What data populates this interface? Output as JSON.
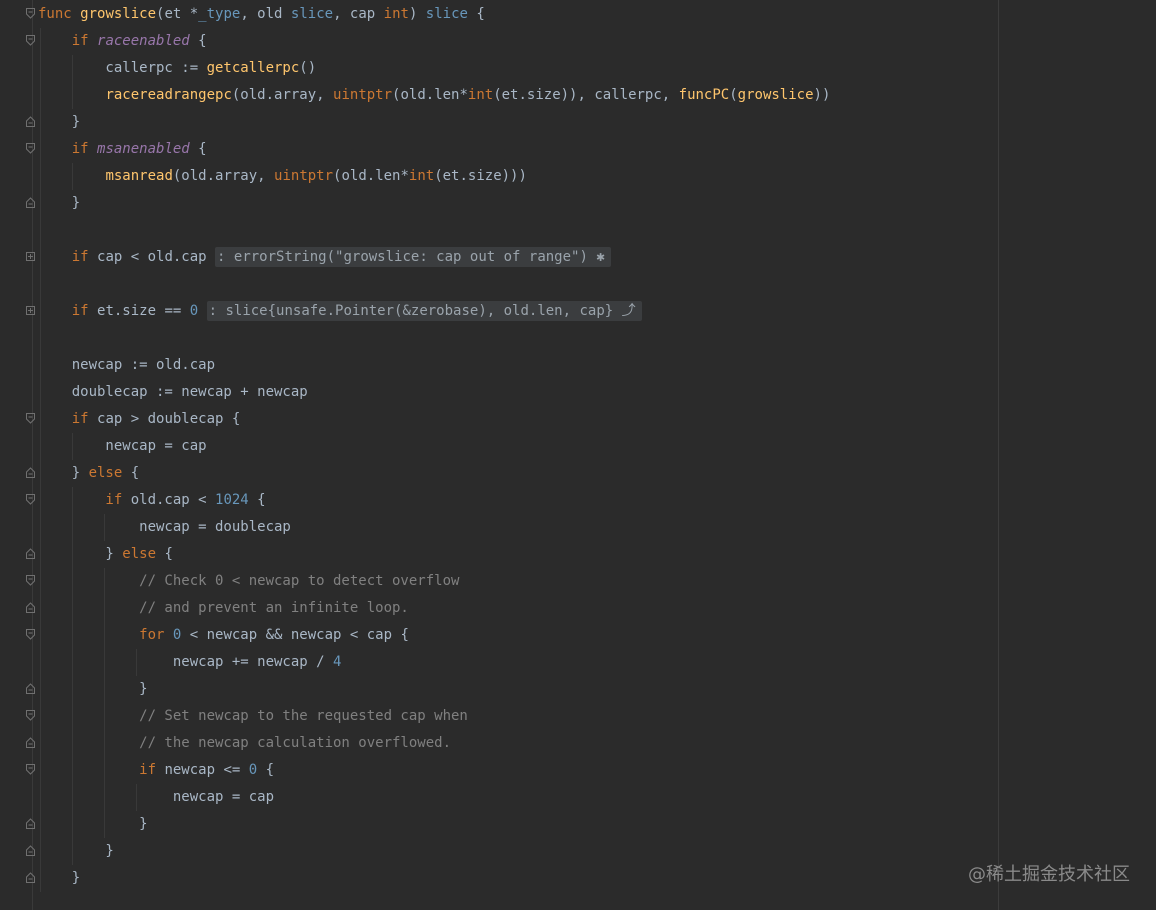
{
  "code_lines": [
    [
      {
        "t": "func ",
        "c": "kw"
      },
      {
        "t": "growslice",
        "c": "fn"
      },
      {
        "t": "(et *",
        "c": "plain"
      },
      {
        "t": "_type",
        "c": "ty2"
      },
      {
        "t": ", old ",
        "c": "plain"
      },
      {
        "t": "slice",
        "c": "ty2"
      },
      {
        "t": ", cap ",
        "c": "plain"
      },
      {
        "t": "int",
        "c": "ty"
      },
      {
        "t": ") ",
        "c": "plain"
      },
      {
        "t": "slice",
        "c": "ty2"
      },
      {
        "t": " {",
        "c": "plain"
      }
    ],
    [
      {
        "t": "    if ",
        "c": "kw"
      },
      {
        "t": "raceenabled",
        "c": "it"
      },
      {
        "t": " {",
        "c": "plain"
      }
    ],
    [
      {
        "t": "        callerpc := ",
        "c": "plain"
      },
      {
        "t": "getcallerpc",
        "c": "call"
      },
      {
        "t": "()",
        "c": "plain"
      }
    ],
    [
      {
        "t": "        ",
        "c": "plain"
      },
      {
        "t": "racereadrangepc",
        "c": "call"
      },
      {
        "t": "(old.array, ",
        "c": "plain"
      },
      {
        "t": "uintptr",
        "c": "kw"
      },
      {
        "t": "(old.len*",
        "c": "plain"
      },
      {
        "t": "int",
        "c": "kw"
      },
      {
        "t": "(et.size)), callerpc, ",
        "c": "plain"
      },
      {
        "t": "funcPC",
        "c": "call"
      },
      {
        "t": "(",
        "c": "plain"
      },
      {
        "t": "growslice",
        "c": "fn"
      },
      {
        "t": "))",
        "c": "plain"
      }
    ],
    [
      {
        "t": "    }",
        "c": "plain"
      }
    ],
    [
      {
        "t": "    if ",
        "c": "kw"
      },
      {
        "t": "msanenabled",
        "c": "it"
      },
      {
        "t": " {",
        "c": "plain"
      }
    ],
    [
      {
        "t": "        ",
        "c": "plain"
      },
      {
        "t": "msanread",
        "c": "call"
      },
      {
        "t": "(old.array, ",
        "c": "plain"
      },
      {
        "t": "uintptr",
        "c": "kw"
      },
      {
        "t": "(old.len*",
        "c": "plain"
      },
      {
        "t": "int",
        "c": "kw"
      },
      {
        "t": "(et.size)))",
        "c": "plain"
      }
    ],
    [
      {
        "t": "    }",
        "c": "plain"
      }
    ],
    [],
    [
      {
        "t": "    if ",
        "c": "kw"
      },
      {
        "t": "cap < old.cap ",
        "c": "plain"
      },
      {
        "t": ": errorString(\"growslice: cap out of range\") ✱",
        "c": "fold-region"
      }
    ],
    [],
    [
      {
        "t": "    if ",
        "c": "kw"
      },
      {
        "t": "et.size == ",
        "c": "plain"
      },
      {
        "t": "0",
        "c": "num"
      },
      {
        "t": " ",
        "c": "plain"
      },
      {
        "t": ": slice{unsafe.Pointer(&zerobase), old.len, cap} ⤴",
        "c": "fold-region"
      }
    ],
    [],
    [
      {
        "t": "    newcap := old.cap",
        "c": "plain"
      }
    ],
    [
      {
        "t": "    doublecap := newcap + newcap",
        "c": "plain"
      }
    ],
    [
      {
        "t": "    if ",
        "c": "kw"
      },
      {
        "t": "cap > doublecap {",
        "c": "plain"
      }
    ],
    [
      {
        "t": "        newcap = cap",
        "c": "plain"
      }
    ],
    [
      {
        "t": "    } ",
        "c": "plain"
      },
      {
        "t": "else",
        "c": "kw"
      },
      {
        "t": " {",
        "c": "plain"
      }
    ],
    [
      {
        "t": "        if ",
        "c": "kw"
      },
      {
        "t": "old.cap < ",
        "c": "plain"
      },
      {
        "t": "1024",
        "c": "num"
      },
      {
        "t": " {",
        "c": "plain"
      }
    ],
    [
      {
        "t": "            newcap = doublecap",
        "c": "plain"
      }
    ],
    [
      {
        "t": "        } ",
        "c": "plain"
      },
      {
        "t": "else",
        "c": "kw"
      },
      {
        "t": " {",
        "c": "plain"
      }
    ],
    [
      {
        "t": "            // Check 0 < newcap to detect overflow",
        "c": "cmt"
      }
    ],
    [
      {
        "t": "            // and prevent an infinite loop.",
        "c": "cmt"
      }
    ],
    [
      {
        "t": "            for ",
        "c": "kw"
      },
      {
        "t": "0",
        "c": "num"
      },
      {
        "t": " < newcap && newcap < cap {",
        "c": "plain"
      }
    ],
    [
      {
        "t": "                newcap += newcap / ",
        "c": "plain"
      },
      {
        "t": "4",
        "c": "num"
      }
    ],
    [
      {
        "t": "            }",
        "c": "plain"
      }
    ],
    [
      {
        "t": "            // Set newcap to the requested cap when",
        "c": "cmt"
      }
    ],
    [
      {
        "t": "            // the newcap calculation overflowed.",
        "c": "cmt"
      }
    ],
    [
      {
        "t": "            if ",
        "c": "kw"
      },
      {
        "t": "newcap <= ",
        "c": "plain"
      },
      {
        "t": "0",
        "c": "num"
      },
      {
        "t": " {",
        "c": "plain"
      }
    ],
    [
      {
        "t": "                newcap = cap",
        "c": "plain"
      }
    ],
    [
      {
        "t": "            }",
        "c": "plain"
      }
    ],
    [
      {
        "t": "        }",
        "c": "plain"
      }
    ],
    [
      {
        "t": "    }",
        "c": "plain"
      }
    ]
  ],
  "fold_markers": {
    "0": "open",
    "1": "open",
    "4": "close",
    "5": "open",
    "7": "close",
    "9": "collapsed",
    "11": "collapsed",
    "15": "open",
    "17": "close",
    "18": "open",
    "20": "close",
    "21": "open",
    "22": "close",
    "23": "open",
    "25": "close",
    "26": "open",
    "27": "close",
    "28": "open",
    "30": "close",
    "31": "close",
    "32": "close"
  },
  "watermark": "@稀土掘金技术社区",
  "colors": {
    "background": "#2b2b2b",
    "keyword": "#cc7832",
    "function": "#ffc66d",
    "constant": "#9876aa",
    "number": "#6897bb",
    "comment": "#808080",
    "text": "#a9b7c6"
  }
}
